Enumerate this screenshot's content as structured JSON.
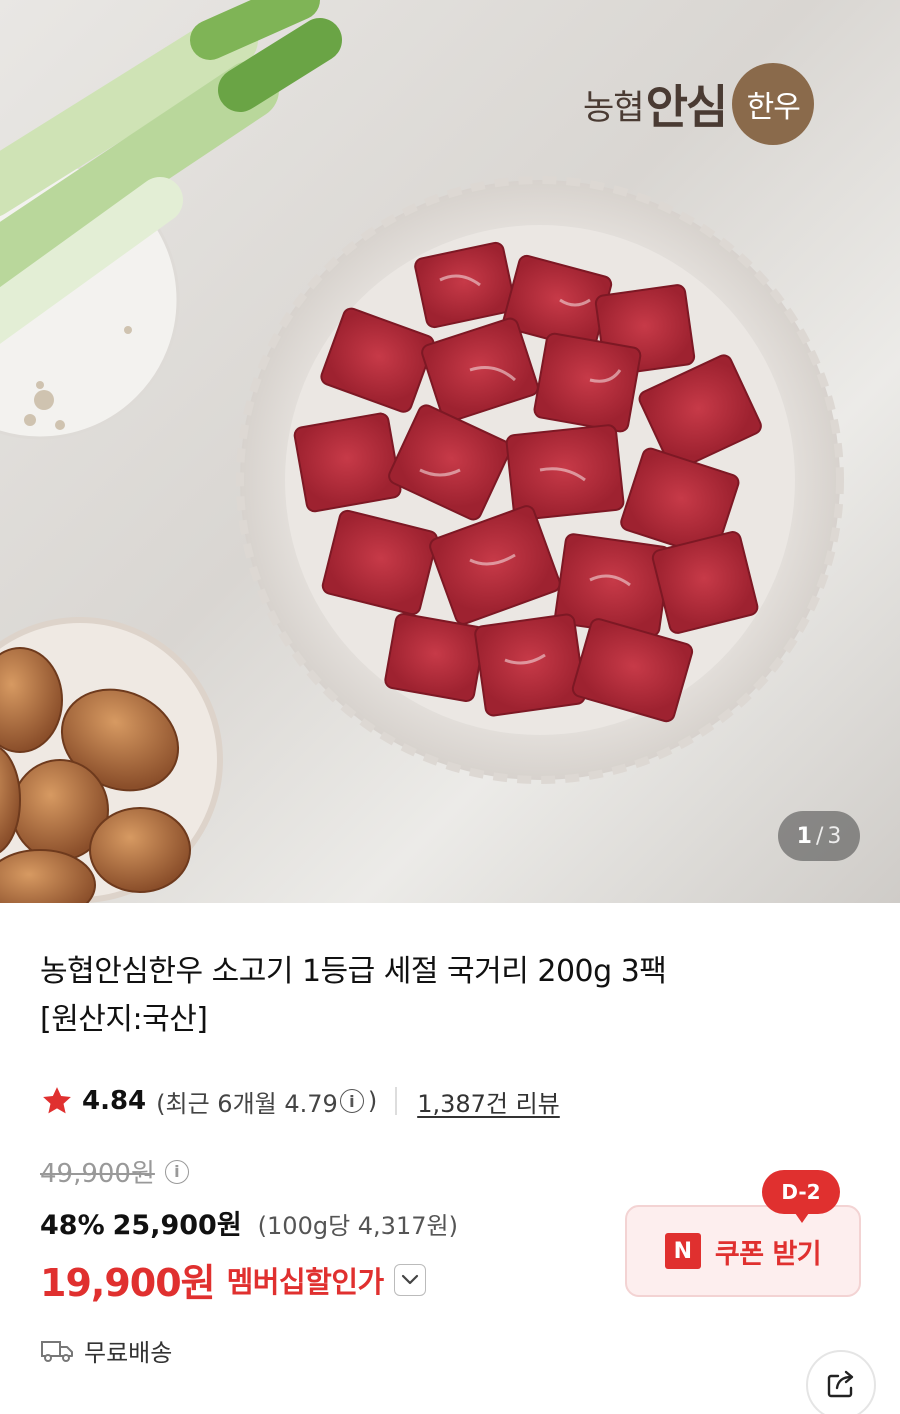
{
  "product_image": {
    "brand": {
      "prefix": "농협",
      "main": "안심",
      "badge": "한우"
    },
    "pager": {
      "current": "1",
      "separator": "/",
      "total": "3"
    }
  },
  "product": {
    "title_line1": "농협안심한우 소고기 1등급 세절 국거리 200g 3팩",
    "title_line2": "[원산지:국산]"
  },
  "rating": {
    "score": "4.84",
    "recent_open": "(최근 6개월 4.79",
    "recent_close": ")",
    "info_glyph": "i",
    "reviews": "1,387건 리뷰"
  },
  "price": {
    "original": "49,900원",
    "discount": "48%",
    "sale": "25,900원",
    "unit": "(100g당 4,317원)",
    "member": "19,900원",
    "member_label": "멤버십할인가"
  },
  "coupon": {
    "dday": "D-2",
    "n_glyph": "N",
    "label": "쿠폰 받기"
  },
  "shipping": {
    "label": "무료배송"
  },
  "colors": {
    "accent": "#e0302f",
    "brand_badge": "#8a6a4b"
  }
}
